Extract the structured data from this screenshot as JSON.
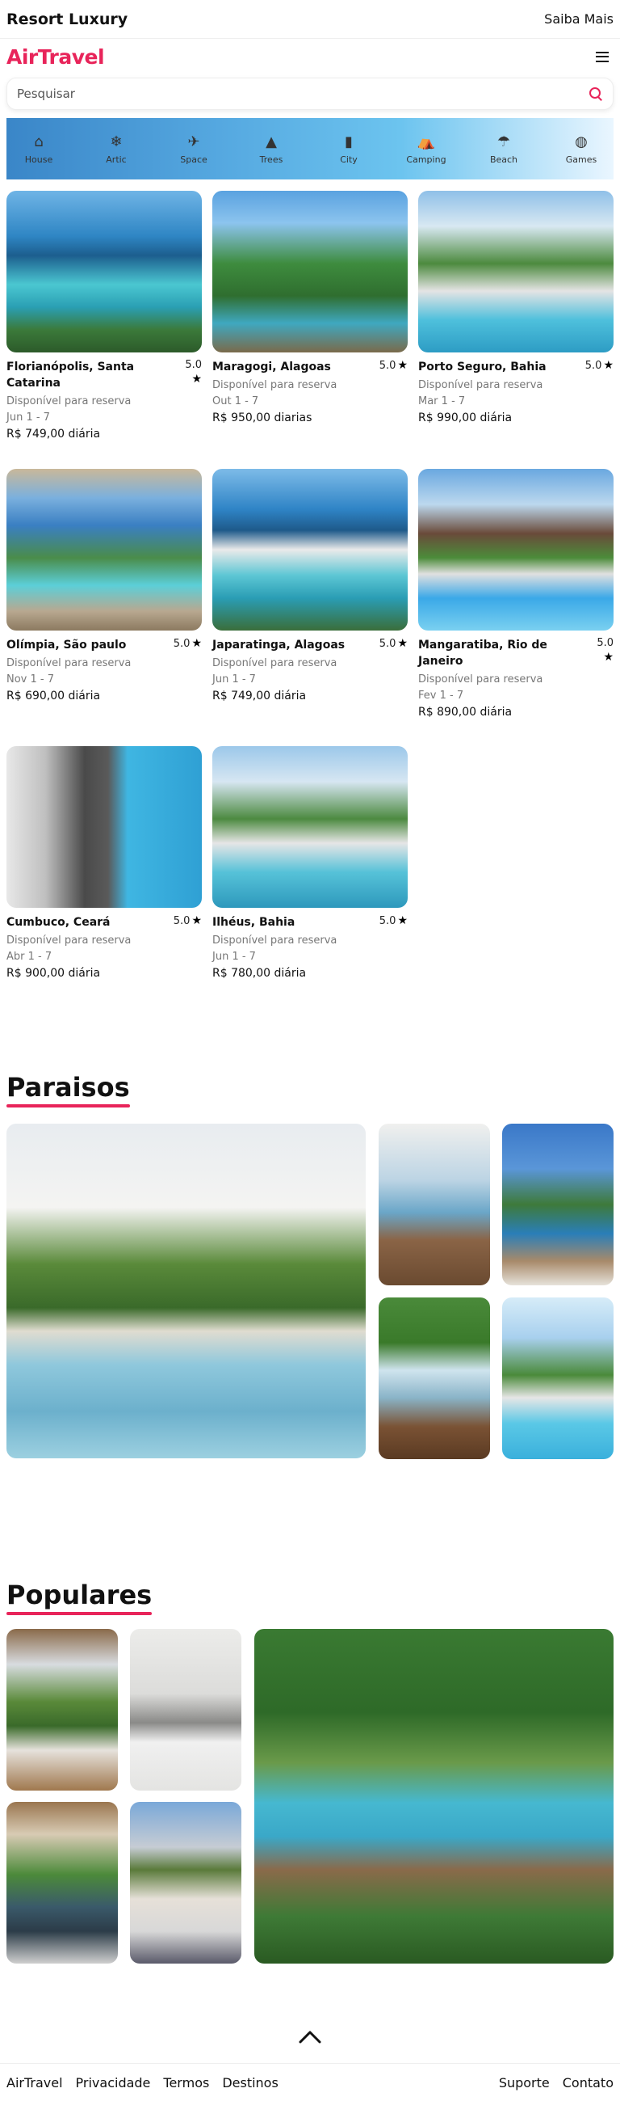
{
  "topbar": {
    "brand": "Resort Luxury",
    "more": "Saiba Mais"
  },
  "navbar": {
    "logo": "AirTravel"
  },
  "search": {
    "placeholder": "Pesquisar"
  },
  "categories": [
    {
      "label": "House",
      "icon": "house-icon",
      "glyph": "⌂"
    },
    {
      "label": "Artic",
      "icon": "snowflake-icon",
      "glyph": "❄"
    },
    {
      "label": "Space",
      "icon": "rocket-icon",
      "glyph": "✈"
    },
    {
      "label": "Trees",
      "icon": "tree-icon",
      "glyph": "▲"
    },
    {
      "label": "City",
      "icon": "building-icon",
      "glyph": "▮"
    },
    {
      "label": "Camping",
      "icon": "tent-icon",
      "glyph": "⛺"
    },
    {
      "label": "Beach",
      "icon": "umbrella-icon",
      "glyph": "☂"
    },
    {
      "label": "Games",
      "icon": "ball-icon",
      "glyph": "◍"
    }
  ],
  "listings": [
    {
      "title": "Florianópolis, Santa Catarina",
      "rating": "5.0",
      "subtitle": "Disponível para reserva",
      "dates": "Jun 1 - 7",
      "price": "R$ 749,00 diária"
    },
    {
      "title": "Maragogi, Alagoas",
      "rating": "5.0",
      "subtitle": "Disponível para reserva",
      "dates": "Out 1 - 7",
      "price": "R$ 950,00 diarias"
    },
    {
      "title": "Porto Seguro, Bahia",
      "rating": "5.0",
      "subtitle": "Disponível para reserva",
      "dates": "Mar 1 - 7",
      "price": "R$ 990,00 diária"
    },
    {
      "title": "Olímpia, São paulo",
      "rating": "5.0",
      "subtitle": "Disponível para reserva",
      "dates": "Nov 1 - 7",
      "price": "R$ 690,00 diária"
    },
    {
      "title": "Japaratinga, Alagoas",
      "rating": "5.0",
      "subtitle": "Disponível para reserva",
      "dates": "Jun 1 - 7",
      "price": "R$ 749,00 diária"
    },
    {
      "title": "Mangaratiba, Rio de Janeiro",
      "rating": "5.0",
      "subtitle": "Disponível para reserva",
      "dates": "Fev 1 - 7",
      "price": "R$ 890,00 diária"
    },
    {
      "title": "Cumbuco, Ceará",
      "rating": "5.0",
      "subtitle": "Disponível para reserva",
      "dates": "Abr 1 - 7",
      "price": "R$ 900,00 diária"
    },
    {
      "title": "Ilhéus, Bahia",
      "rating": "5.0",
      "subtitle": "Disponível para reserva",
      "dates": "Jun 1 - 7",
      "price": "R$ 780,00 diária"
    }
  ],
  "sections": {
    "paraisos": "Paraisos",
    "populares": "Populares"
  },
  "footer": {
    "left": [
      "AirTravel",
      "Privacidade",
      "Termos",
      "Destinos"
    ],
    "right": [
      "Suporte",
      "Contato"
    ]
  },
  "colors": {
    "accent": "#e8245a"
  }
}
